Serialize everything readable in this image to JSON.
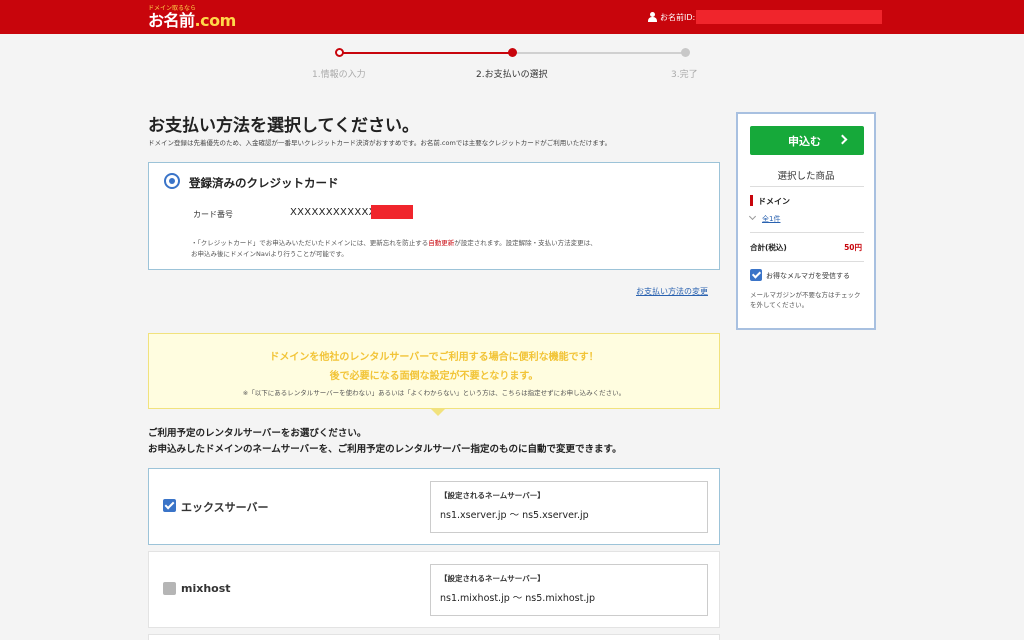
{
  "header": {
    "logo_tagline": "ドメイン取るなら",
    "logo_text": "お名前",
    "logo_suffix": ".com",
    "user_label": "お名前ID:"
  },
  "steps": [
    {
      "label": "1.情報の入力",
      "state": "done"
    },
    {
      "label": "2.お支払いの選択",
      "state": "current"
    },
    {
      "label": "3.完了",
      "state": "todo"
    }
  ],
  "main": {
    "title": "お支払い方法を選択してください。",
    "subtitle": "ドメイン登録は先着優先のため、入金確認が一番早いクレジットカード決済がおすすめです。お名前.comでは主要なクレジットカードがご利用いただけます。"
  },
  "card": {
    "title": "登録済みのクレジットカード",
    "number_label": "カード番号",
    "number_value": "XXXXXXXXXXXX",
    "note_line1_a": "・「クレジットカード」でお申込みいただいたドメインには、更新忘れを防止する",
    "note_line1_red": "自動更新",
    "note_line1_b": "が設定されます。設定解除・支払い方法変更は、",
    "note_line2": "お申込み後にドメインNaviより行うことが可能です。"
  },
  "change_payment_link": "お支払い方法の変更",
  "promo": {
    "line1": "ドメインを他社のレンタルサーバーでご利用する場合に便利な機能です！",
    "line2": "後で必要になる面倒な設定が不要となります。",
    "note": "※「以下にあるレンタルサーバーを使わない」あるいは「よくわからない」という方は、こちらは指定せずにお申し込みください。"
  },
  "server_section": {
    "intro1": "ご利用予定のレンタルサーバーをお選びください。",
    "intro2": "お申込みしたドメインのネームサーバーを、ご利用予定のレンタルサーバー指定のものに自動で変更できます。",
    "ns_heading": "【設定されるネームサーバー】",
    "servers": [
      {
        "name": "エックスサーバー",
        "checked": true,
        "nameservers": "ns1.xserver.jp 〜 ns5.xserver.jp"
      },
      {
        "name": "mixhost",
        "checked": false,
        "nameservers": "ns1.mixhost.jp 〜 ns5.mixhost.jp"
      }
    ]
  },
  "sidebar": {
    "apply_button": "申込む",
    "selected_title": "選択した商品",
    "domain_label": "ドメイン",
    "count_link": "全1件",
    "total_label": "合計(税込)",
    "total_value": "50円",
    "mailmag_label": "お得なメルマガを受信する",
    "mailmag_checked": true,
    "mailmag_note": "メールマガジンが不要な方はチェックを外してください。"
  },
  "colors": {
    "brand_red": "#c8050c",
    "apply_green": "#16a93a",
    "accent_blue": "#3a74c8",
    "promo_yellow": "#f2c437"
  }
}
